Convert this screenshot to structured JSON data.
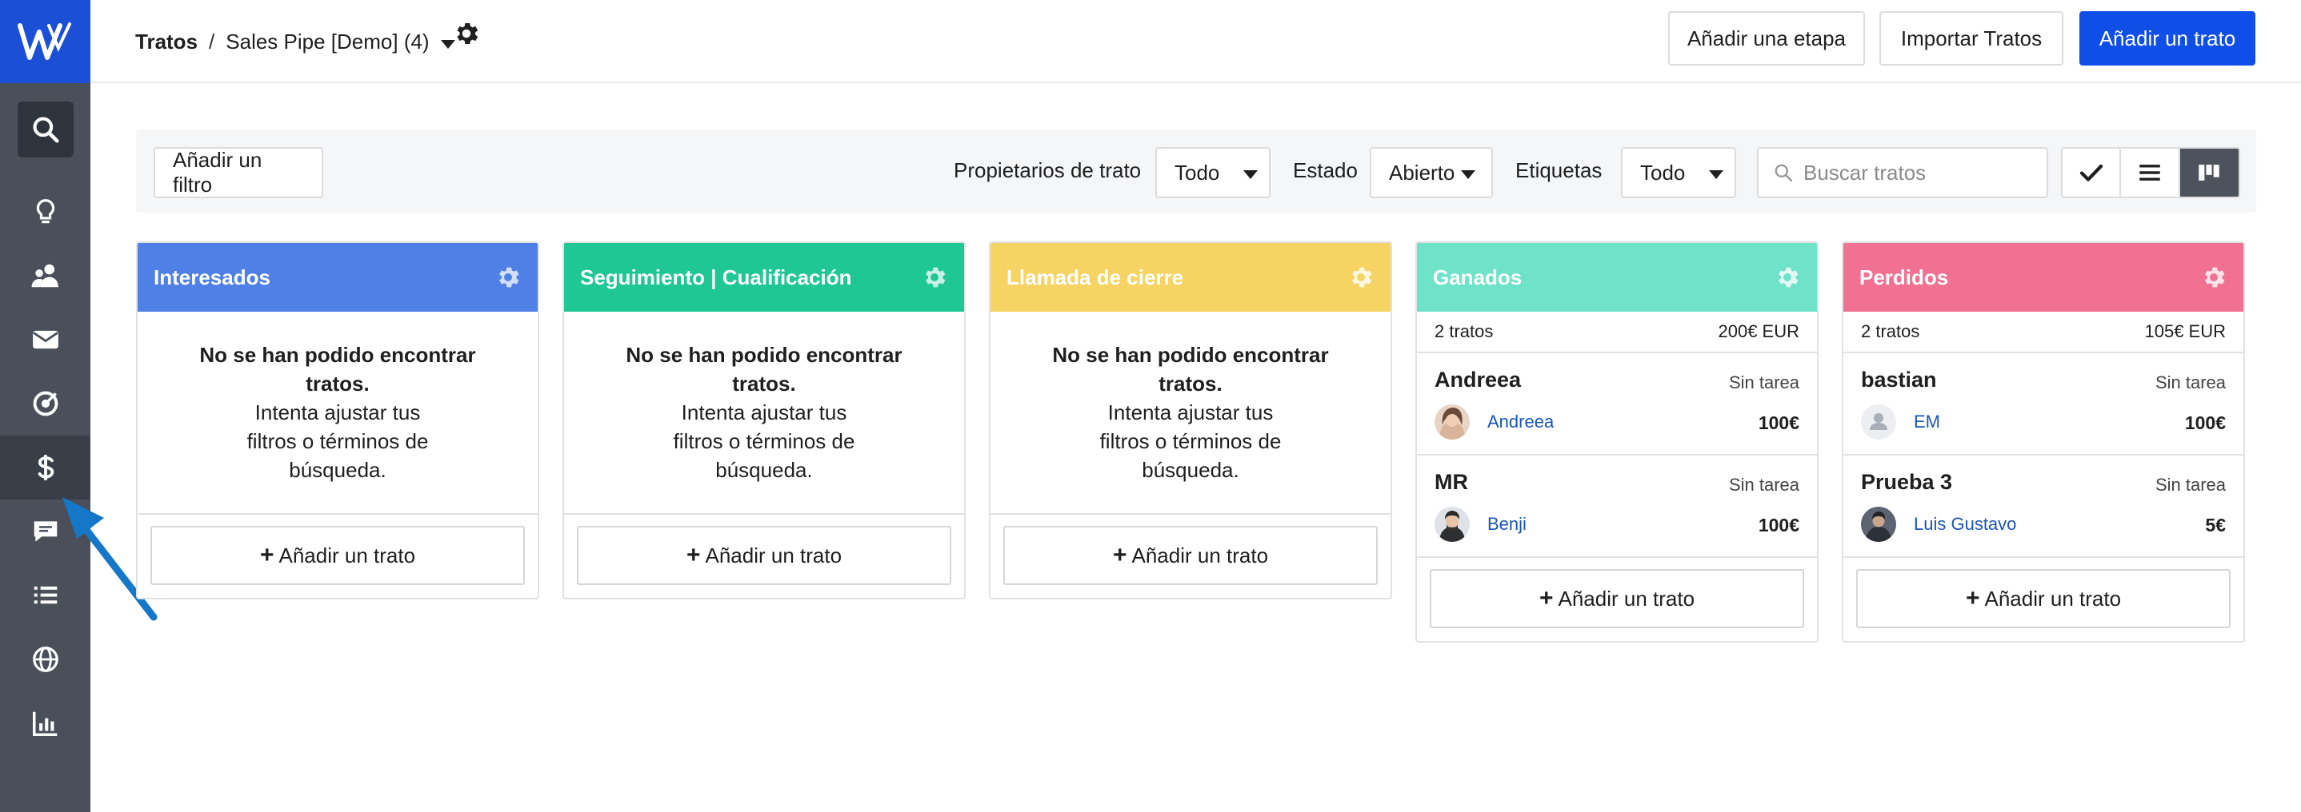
{
  "app": {
    "accent": "#0f4fe8",
    "sidebar_bg": "#4a4f5a"
  },
  "header": {
    "breadcrumb_root": "Tratos",
    "separator": "/",
    "pipeline": "Sales Pipe [Demo] (4)",
    "buttons": {
      "add_stage": "Añadir una etapa",
      "import": "Importar Tratos",
      "add_deal": "Añadir un trato"
    }
  },
  "sidebar": {
    "items": [
      {
        "icon": "search-icon"
      },
      {
        "icon": "lightbulb-icon"
      },
      {
        "icon": "contacts-icon"
      },
      {
        "icon": "mail-icon"
      },
      {
        "icon": "target-icon"
      },
      {
        "icon": "dollar-icon",
        "active": true
      },
      {
        "icon": "chat-icon"
      },
      {
        "icon": "list-icon"
      },
      {
        "icon": "globe-icon"
      },
      {
        "icon": "bar-chart-icon"
      }
    ]
  },
  "filters": {
    "add_filter": "Añadir un filtro",
    "owners_label": "Propietarios de trato",
    "owners_value": "Todo",
    "state_label": "Estado",
    "state_value": "Abierto",
    "tags_label": "Etiquetas",
    "tags_value": "Todo",
    "search_placeholder": "Buscar tratos"
  },
  "board": {
    "add_deal": "Añadir un trato",
    "empty_title": "No se han podido encontrar tratos.",
    "empty_line1": "Intenta ajustar tus",
    "empty_line2": "filtros o términos de",
    "empty_line3": "búsqueda.",
    "columns": [
      {
        "title": "Interesados",
        "color": "#4f80e6"
      },
      {
        "title": "Seguimiento | Cualificación",
        "color": "#1fc795"
      },
      {
        "title": "Llamada de cierre",
        "color": "#f6d463"
      },
      {
        "title": "Ganados",
        "color": "#6ee3c8",
        "count": "2 tratos",
        "total": "200€ EUR",
        "deals": [
          {
            "name": "Andreea",
            "task": "Sin tarea",
            "owner": "Andreea",
            "value": "100€"
          },
          {
            "name": "MR",
            "task": "Sin tarea",
            "owner": "Benji",
            "value": "100€"
          }
        ]
      },
      {
        "title": "Perdidos",
        "color": "#f07192",
        "count": "2 tratos",
        "total": "105€ EUR",
        "deals": [
          {
            "name": "bastian",
            "task": "Sin tarea",
            "owner": "EM",
            "value": "100€"
          },
          {
            "name": "Prueba 3",
            "task": "Sin tarea",
            "owner": "Luis Gustavo",
            "value": "5€"
          }
        ]
      }
    ]
  }
}
